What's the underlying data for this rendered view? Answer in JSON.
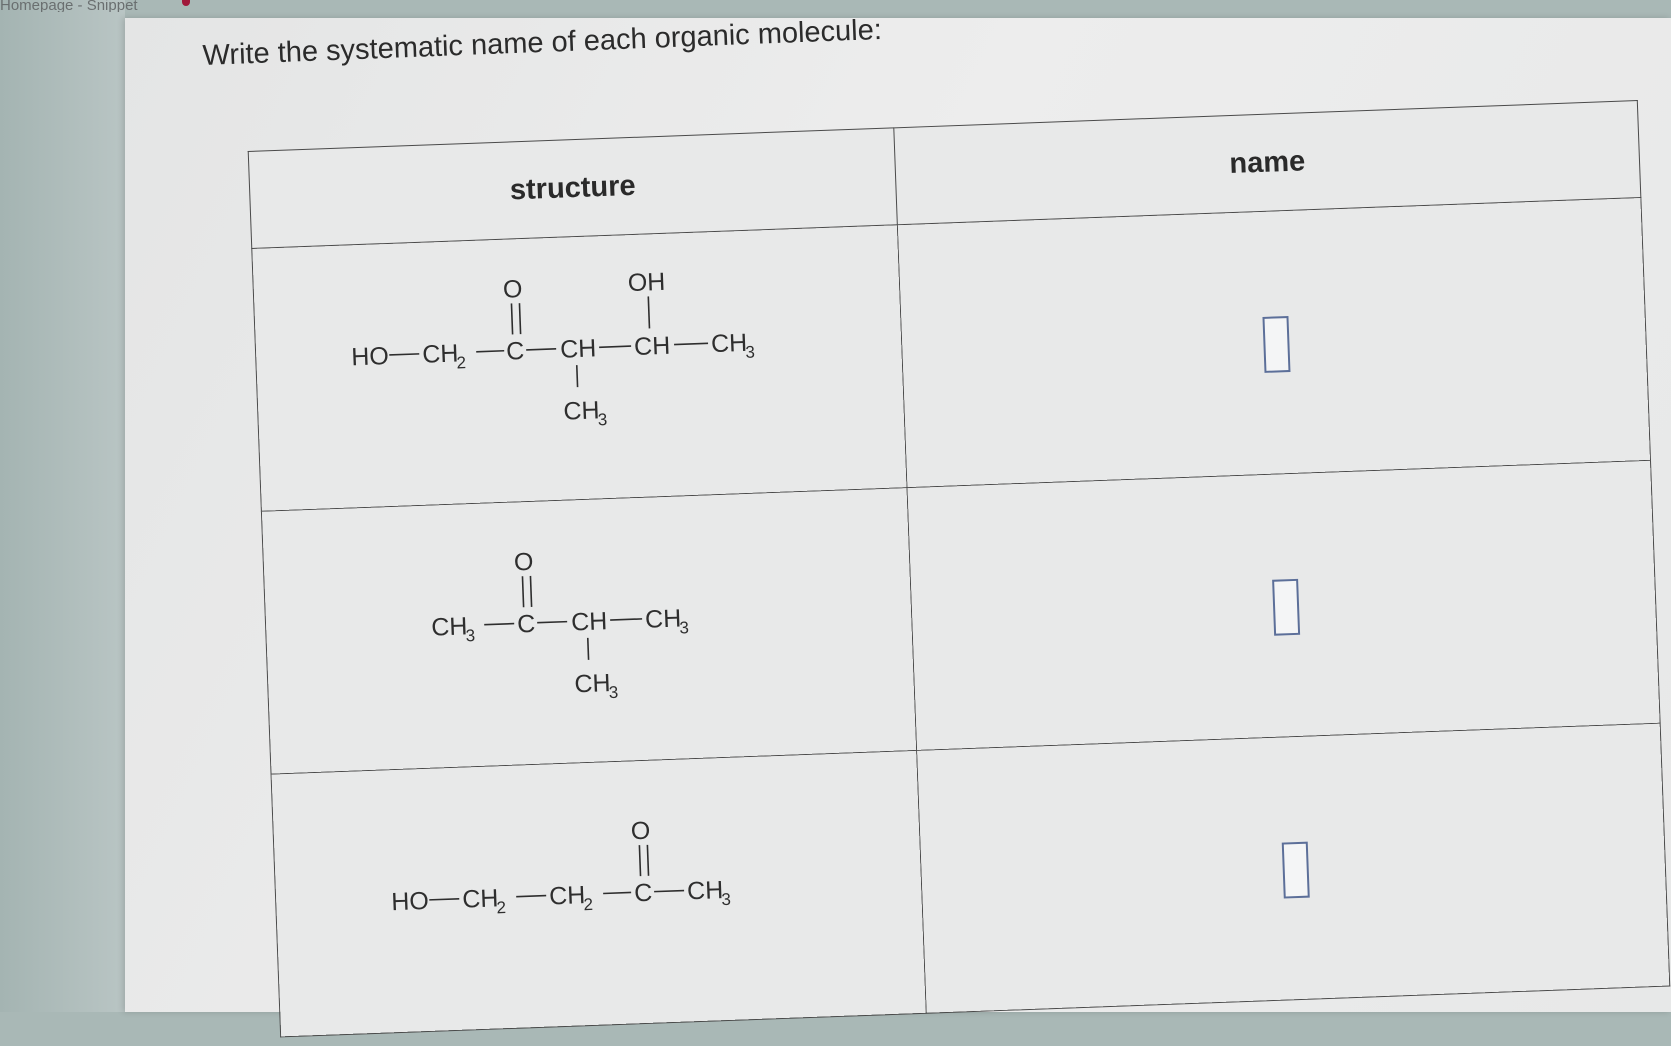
{
  "browser_tab": {
    "label": "Homepage - Snippet"
  },
  "question": {
    "prompt": "Write the systematic name of each organic molecule:"
  },
  "table": {
    "headers": {
      "structure": "structure",
      "name": "name"
    },
    "rows": [
      {
        "structure": {
          "ho": "HO",
          "ch2": "CH",
          "sub2": "2",
          "c": "C",
          "o": "O",
          "ch_a": "CH",
          "ch3_branch": "CH",
          "sub3_branch": "3",
          "ch_b": "CH",
          "oh": "OH",
          "ch3_end": "CH",
          "sub3_end": "3"
        },
        "name_value": ""
      },
      {
        "structure": {
          "ch3_start": "CH",
          "sub3_start": "3",
          "c": "C",
          "o": "O",
          "ch": "CH",
          "ch3_branch": "CH",
          "sub3_branch": "3",
          "ch3_end": "CH",
          "sub3_end": "3"
        },
        "name_value": ""
      },
      {
        "structure": {
          "ho": "HO",
          "ch2_a": "CH",
          "sub2_a": "2",
          "ch2_b": "CH",
          "sub2_b": "2",
          "c": "C",
          "o": "O",
          "ch3_end": "CH",
          "sub3_end": "3"
        },
        "name_value": ""
      }
    ]
  }
}
